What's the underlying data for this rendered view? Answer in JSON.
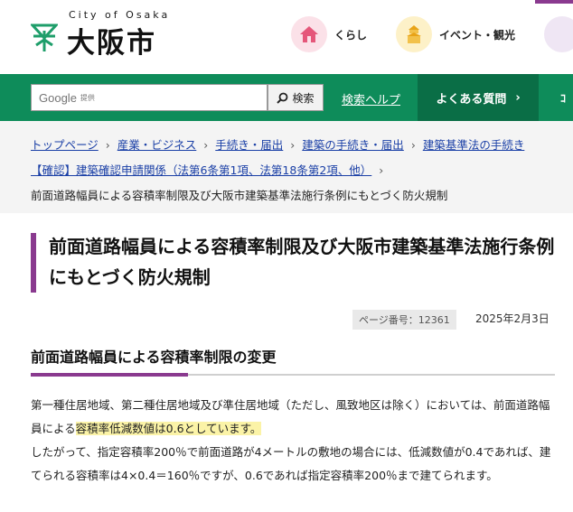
{
  "header": {
    "logo_city": "City of Osaka",
    "logo_name": "大阪市",
    "nav": [
      {
        "label": "くらし",
        "icon": "house-icon"
      },
      {
        "label": "イベント・観光",
        "icon": "castle-icon"
      }
    ]
  },
  "search": {
    "placeholder_brand": "Google",
    "placeholder_sub": "提供",
    "button_label": "検索",
    "help_label": "検索ヘルプ",
    "faq_label": "よくある質問",
    "faq_chevron": "›",
    "edge_label": "ｺ"
  },
  "breadcrumb": {
    "items": [
      "トップページ",
      "産業・ビジネス",
      "手続き・届出",
      "建築の手続き・届出",
      "建築基準法の手続き"
    ],
    "item6": "【確認】建築確認申請関係（法第6条第1項、法第18条第2項、他）",
    "separator": "›",
    "current": "前面道路幅員による容積率制限及び大阪市建築基準法施行条例にもとづく防火規制"
  },
  "page": {
    "title": "前面道路幅員による容積率制限及び大阪市建築基準法施行条例にもとづく防火規制",
    "page_number": "ページ番号：12361",
    "date": "2025年2月3日"
  },
  "section": {
    "heading": "前面道路幅員による容積率制限の変更",
    "p1_before": "第一種住居地域、第二種住居地域及び準住居地域（ただし、風致地区は除く）においては、前面道路幅員による",
    "p1_highlight": "容積率低減数値は0.6としています。",
    "p2": "したがって、指定容積率200％で前面道路が4メートルの敷地の場合には、低減数値が0.4であれば、建てられる容積率は4×0.4＝160％ですが、0.6であれば指定容積率200％まで建てられます。"
  },
  "colors": {
    "green": "#0e8c5a",
    "accent_purple": "#8a3a8f",
    "link_blue": "#1a3fa6",
    "highlight": "#fbf3a7"
  }
}
